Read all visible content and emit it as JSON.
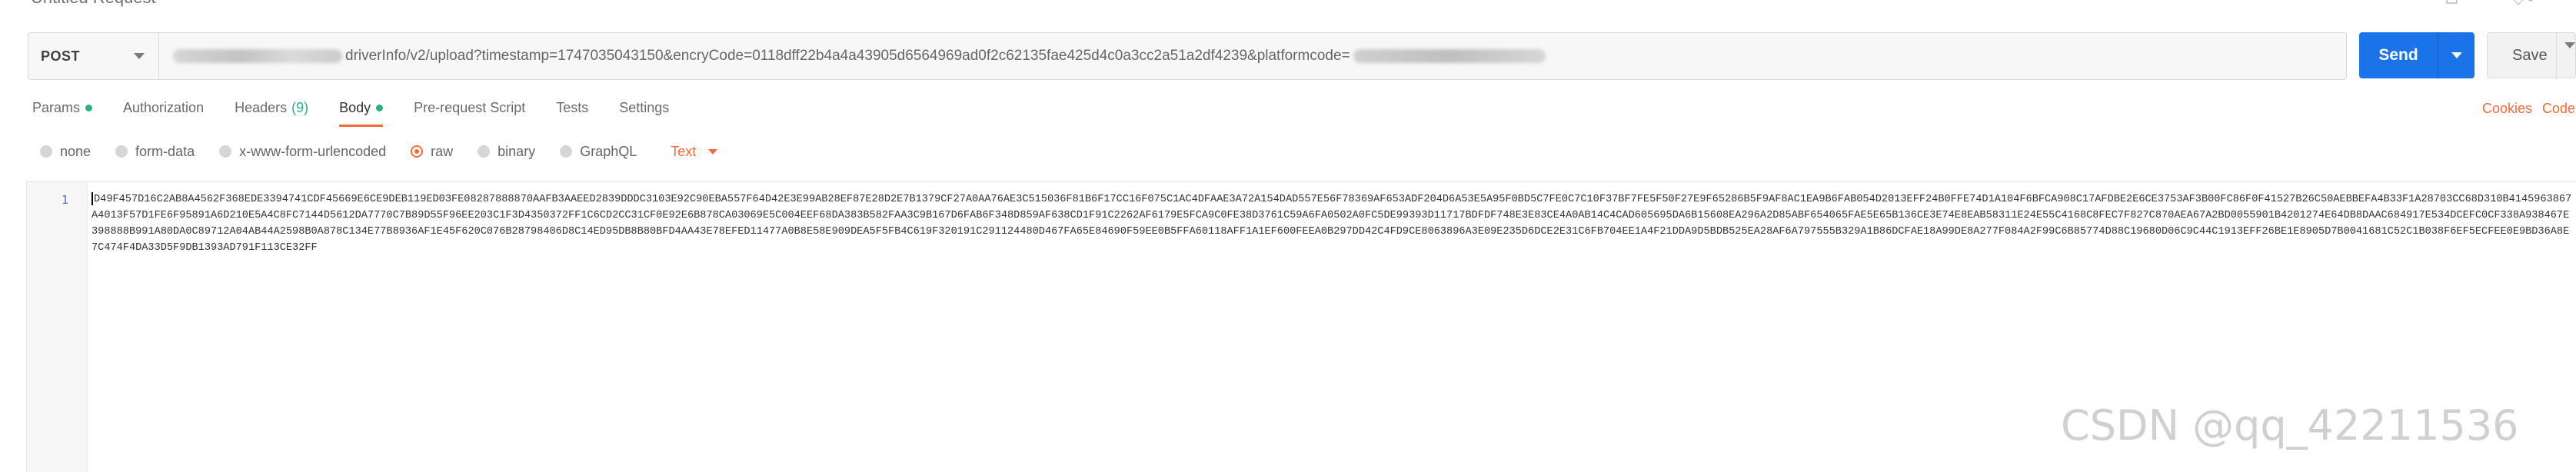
{
  "window": {
    "title": "Untitled Request"
  },
  "request": {
    "method": "POST",
    "url_visible": "driverInfo/v2/upload?timestamp=1747035043150&encryCode=0118dff22b4a4a43905d6564969ad0f2c62135fae425d4c0a3cc2a51a2df4239&platformcode=",
    "send_label": "Send",
    "save_label": "Save"
  },
  "tabs": [
    {
      "label": "Params",
      "dot": true
    },
    {
      "label": "Authorization"
    },
    {
      "label": "Headers",
      "count": "(9)"
    },
    {
      "label": "Body",
      "dot": true,
      "active": true
    },
    {
      "label": "Pre-request Script"
    },
    {
      "label": "Tests"
    },
    {
      "label": "Settings"
    }
  ],
  "links": {
    "cookies": "Cookies",
    "code": "Code"
  },
  "body_types": [
    {
      "label": "none"
    },
    {
      "label": "form-data"
    },
    {
      "label": "x-www-form-urlencoded"
    },
    {
      "label": "raw",
      "selected": true
    },
    {
      "label": "binary"
    },
    {
      "label": "GraphQL"
    }
  ],
  "body_format": "Text",
  "editor": {
    "line_number": "1",
    "content": "D49F457D16C2AB8A4562F368EDE3394741CDF45669E6CE9DEB119ED03FE08287888870AAFB3AAEED2839DDDC3103E92C90EBA557F64D42E3E99AB28EF87E28D2E7B1379CF27A0AA76AE3C515036F81B6F17CC16F075C1AC4DFAAE3A72A154DAD557E56F78369AF653ADF204D6A53E5A95F0BD5C7FE0C7C10F37BF7FE5F50F27E9F65286B5F9AF8AC1EA9B6FAB054D2013EFF24B0FFE74D1A104F6BFCA908C17AFDBE2E6CE3753AF3B00FC86F0F41527B26C50AEBBEFA4B33F1A28703CC68D310B4145963867A4013F57D1FE6F95891A6D210E5A4C8FC7144D5612DA7770C7B89D55F96EE203C1F3D4350372FF1C6CD2CC31CF0E92E6B878CA03069E5C004EEF68DA383B582FAA3C9B167D6FAB6F348D859AF638CD1F91C2262AF6179E5FCA9C0FE38D3761C59A6FA0502A0FC5DE99393D11717BDFDF748E3E83CE4A0AB14C4CAD605695DA6B15608EA296A2D85ABF654065FAE5E65B136CE3E74E8EAB58311E24E55C4168C8FEC7F827C870AEA67A2BD0055901B4201274E64DB8DAAC684917E534DCEFC0CF338A938467E398888B991A80DA0C89712A04AB44A2598B0A878C134E77B8936AF1E45F620C076B28798406D8C14ED95DB8B80BFD4AA43E78EFED11477A0B8E58E909DEA5F5FB4C619F320191C291124480D467FA65E84690F59EE0B5FFA60118AFF1A1EF600FEEA0B297DD42C4FD9CE8063896A3E09E235D6DCE2E31C6FB704EE1A4F21DDA9D5BDB525EA28AF6A797555B329A1B86DCFAE18A99DE8A277F084A2F99C6B85774D88C19680D06C9C44C1913EFF26BE1E8905D7B0041681C52C1B038F6EF5ECFEE0E9BD36A8E7C474F4DA33D5F9DB1393AD791F113CE32FF"
  },
  "watermark": "CSDN @qq_42211536"
}
